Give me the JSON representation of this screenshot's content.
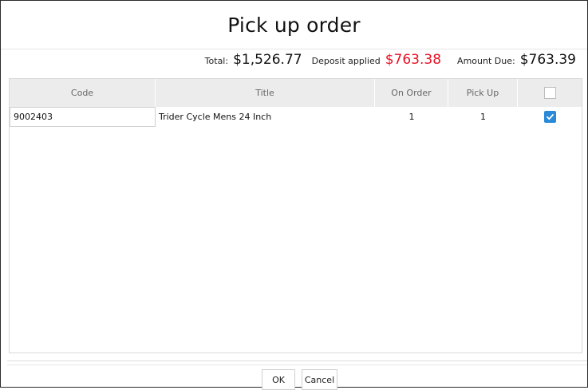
{
  "dialog": {
    "title": "Pick up order"
  },
  "totals": {
    "total_label": "Total:",
    "total_value": "$1,526.77",
    "deposit_label": "Deposit applied",
    "deposit_value": "$763.38",
    "due_label": "Amount Due:",
    "due_value": "$763.39",
    "deposit_color": "#e81123"
  },
  "grid": {
    "columns": {
      "code": "Code",
      "title": "Title",
      "on_order": "On Order",
      "pick_up": "Pick Up"
    },
    "rows": [
      {
        "code": "9002403",
        "title": "Trider Cycle Mens 24 Inch",
        "on_order": "1",
        "pick_up": "1",
        "selected": true
      }
    ],
    "header_checkbox_checked": false,
    "accent_color": "#2b8ad8"
  },
  "buttons": {
    "ok": "OK",
    "cancel": "Cancel"
  }
}
